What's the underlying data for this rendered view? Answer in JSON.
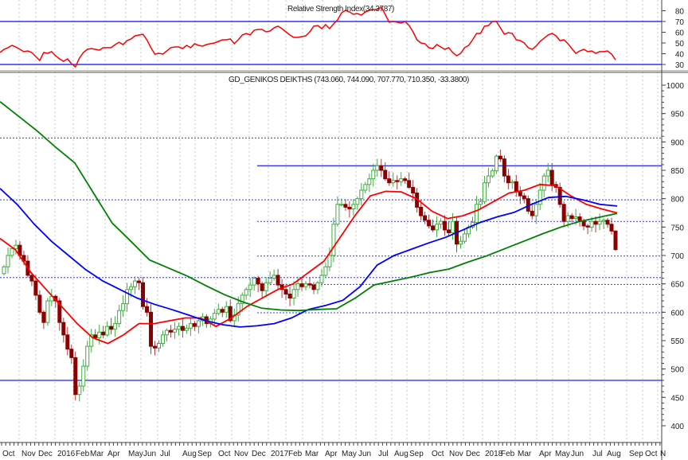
{
  "chart_data": [
    {
      "type": "line",
      "panel": "rsi",
      "title_prefix": "Relative Strength Index",
      "title_value": "(34.3787)",
      "ylim": [
        20,
        85
      ],
      "yticks": [
        80,
        70,
        60,
        50,
        40,
        30
      ],
      "levels": [
        70,
        30
      ],
      "series": [
        {
          "name": "RSI",
          "color": "#ff0000",
          "values": [
            41.1,
            44.1,
            45.6,
            47.8,
            46.3,
            44.1,
            41.9,
            42.6,
            41.1,
            37.4,
            33.7,
            41.1,
            40.4,
            41.9,
            38.1,
            35.2,
            33,
            35.2,
            30.7,
            27.8,
            35.9,
            41.1,
            44.1,
            44.8,
            44.1,
            43.3,
            45.6,
            45.6,
            45.6,
            48.5,
            50.7,
            48.5,
            52.2,
            53.7,
            56.7,
            57.4,
            58.1,
            53,
            45.6,
            39.6,
            40.4,
            39.6,
            42.6,
            45.6,
            46.3,
            46.3,
            44.8,
            47.8,
            45.6,
            49.3,
            47.8,
            47,
            48.5,
            49.3,
            50,
            51.5,
            53,
            53,
            53.7,
            49.3,
            53,
            57.4,
            58.9,
            57.4,
            61.9,
            62.6,
            62.6,
            60.4,
            61.1,
            64.1,
            65.6,
            63.3,
            60.4,
            57.4,
            55.2,
            55.2,
            55.9,
            56.7,
            60.4,
            65.6,
            66.3,
            63.3,
            67,
            63.3,
            67.8,
            71.5,
            78.1,
            80.4,
            78.9,
            76.7,
            77.4,
            75.9,
            78.9,
            80.4,
            81.1,
            81.1,
            83.3,
            76.7,
            69.3,
            70,
            69.3,
            68.5,
            70,
            66.3,
            60.4,
            53,
            50,
            49.3,
            45.6,
            44.8,
            48.5,
            46.3,
            44.1,
            45.6,
            41.1,
            38.1,
            40.4,
            45.6,
            47.8,
            53,
            58.9,
            58.9,
            65.6,
            66.3,
            70,
            70,
            64.1,
            58.1,
            59.6,
            58.9,
            53,
            52.2,
            50,
            45.6,
            44.1,
            47,
            51.5,
            54.4,
            57.4,
            58.9,
            56.7,
            52.2,
            53,
            49.3,
            44.8,
            40.4,
            42.6,
            44.1,
            41.9,
            42.6,
            40.4,
            41.9,
            41.9,
            42.6,
            39.6,
            34.4
          ]
        }
      ]
    },
    {
      "type": "candlestick",
      "panel": "price",
      "title": "GD_GENIKOS DEIKTHS (743.060, 744.090, 707.770, 710.350, -33.3800)",
      "last_bar": {
        "open": 743.06,
        "high": 744.09,
        "low": 707.77,
        "close": 710.35,
        "change": -33.38
      },
      "ylim": [
        380,
        1015
      ],
      "yticks": [
        1000,
        950,
        900,
        850,
        800,
        750,
        700,
        650,
        600,
        550,
        500,
        450,
        400
      ],
      "xlabels": [
        "Oct",
        "Nov",
        "Dec",
        "2016",
        "Feb",
        "Mar",
        "Apr",
        "May",
        "Jun",
        "Jul",
        "Aug",
        "Sep",
        "Oct",
        "Nov",
        "Dec",
        "2017",
        "Feb",
        "Mar",
        "Apr",
        "May",
        "Jun",
        "Jul",
        "Aug",
        "Sep",
        "Oct",
        "Nov",
        "Dec",
        "2018",
        "Feb",
        "Mar",
        "Apr",
        "May",
        "Jun",
        "Jul",
        "Aug",
        "Sep",
        "Oct",
        "N"
      ],
      "closes": [
        680,
        700,
        712,
        718,
        700,
        690,
        665,
        655,
        630,
        600,
        582,
        620,
        628,
        620,
        582,
        560,
        535,
        520,
        455,
        470,
        505,
        540,
        560,
        555,
        565,
        560,
        575,
        570,
        580,
        603,
        615,
        640,
        645,
        655,
        652,
        610,
        600,
        540,
        537,
        545,
        560,
        568,
        565,
        570,
        575,
        568,
        572,
        580,
        575,
        585,
        592,
        580,
        588,
        598,
        605,
        600,
        610,
        585,
        595,
        615,
        630,
        640,
        648,
        660,
        650,
        638,
        652,
        660,
        665,
        648,
        640,
        632,
        625,
        640,
        650,
        645,
        650,
        648,
        640,
        652,
        665,
        680,
        700,
        755,
        790,
        790,
        785,
        782,
        790,
        800,
        815,
        825,
        835,
        850,
        858,
        850,
        835,
        828,
        832,
        830,
        835,
        832,
        820,
        810,
        785,
        770,
        762,
        752,
        745,
        755,
        760,
        745,
        740,
        760,
        720,
        725,
        738,
        750,
        758,
        790,
        795,
        828,
        840,
        849,
        875,
        870,
        840,
        828,
        830,
        812,
        805,
        800,
        778,
        770,
        790,
        815,
        840,
        850,
        825,
        820,
        790,
        760,
        770,
        765,
        768,
        760,
        752,
        750,
        760,
        755,
        760,
        762,
        755,
        743,
        710.35
      ],
      "moving_averages": [
        {
          "name": "MA short",
          "color": "#ff0000",
          "values": [
            730,
            710,
            670,
            640,
            610,
            580,
            555,
            545,
            560,
            580,
            580,
            585,
            590,
            590,
            575,
            590,
            610,
            625,
            640,
            650,
            670,
            690,
            730,
            770,
            805,
            813,
            812,
            800,
            778,
            765,
            770,
            780,
            795,
            810,
            815,
            825,
            823,
            805,
            790,
            782,
            775
          ]
        },
        {
          "name": "MA medium",
          "color": "#0000ff",
          "values": [
            818,
            790,
            755,
            725,
            700,
            675,
            655,
            640,
            625,
            614,
            605,
            595,
            585,
            578,
            574,
            576,
            580,
            590,
            605,
            612,
            621,
            645,
            683,
            700,
            711,
            722,
            732,
            745,
            758,
            768,
            776,
            790,
            802,
            804,
            798,
            790,
            787
          ]
        },
        {
          "name": "MA long",
          "color": "#008000",
          "values": [
            971,
            945,
            919,
            890,
            863,
            810,
            757,
            725,
            692,
            678,
            664,
            647,
            631,
            618,
            607,
            604,
            603,
            605,
            606,
            625,
            648,
            655,
            662,
            670,
            676,
            688,
            699,
            712,
            725,
            738,
            750,
            760,
            767,
            774
          ]
        }
      ],
      "levels": [
        {
          "value": 907,
          "style": "dotted",
          "span": "full"
        },
        {
          "value": 858,
          "style": "solid",
          "span": "right"
        },
        {
          "value": 798,
          "style": "dotted",
          "span": "full"
        },
        {
          "value": 760,
          "style": "dotted",
          "span": "right"
        },
        {
          "value": 699,
          "style": "dotted",
          "span": "right"
        },
        {
          "value": 661,
          "style": "dotted",
          "span": "full"
        },
        {
          "value": 649,
          "style": "dotted",
          "span": "right"
        },
        {
          "value": 599,
          "style": "dotted",
          "span": "right"
        },
        {
          "value": 480,
          "style": "solid",
          "span": "full"
        }
      ]
    }
  ],
  "colors": {
    "up": "#3fae3f",
    "down": "#8b0000",
    "down_wick": "#a84040",
    "level": "#3333ff",
    "grid": "#c8c8c8"
  }
}
